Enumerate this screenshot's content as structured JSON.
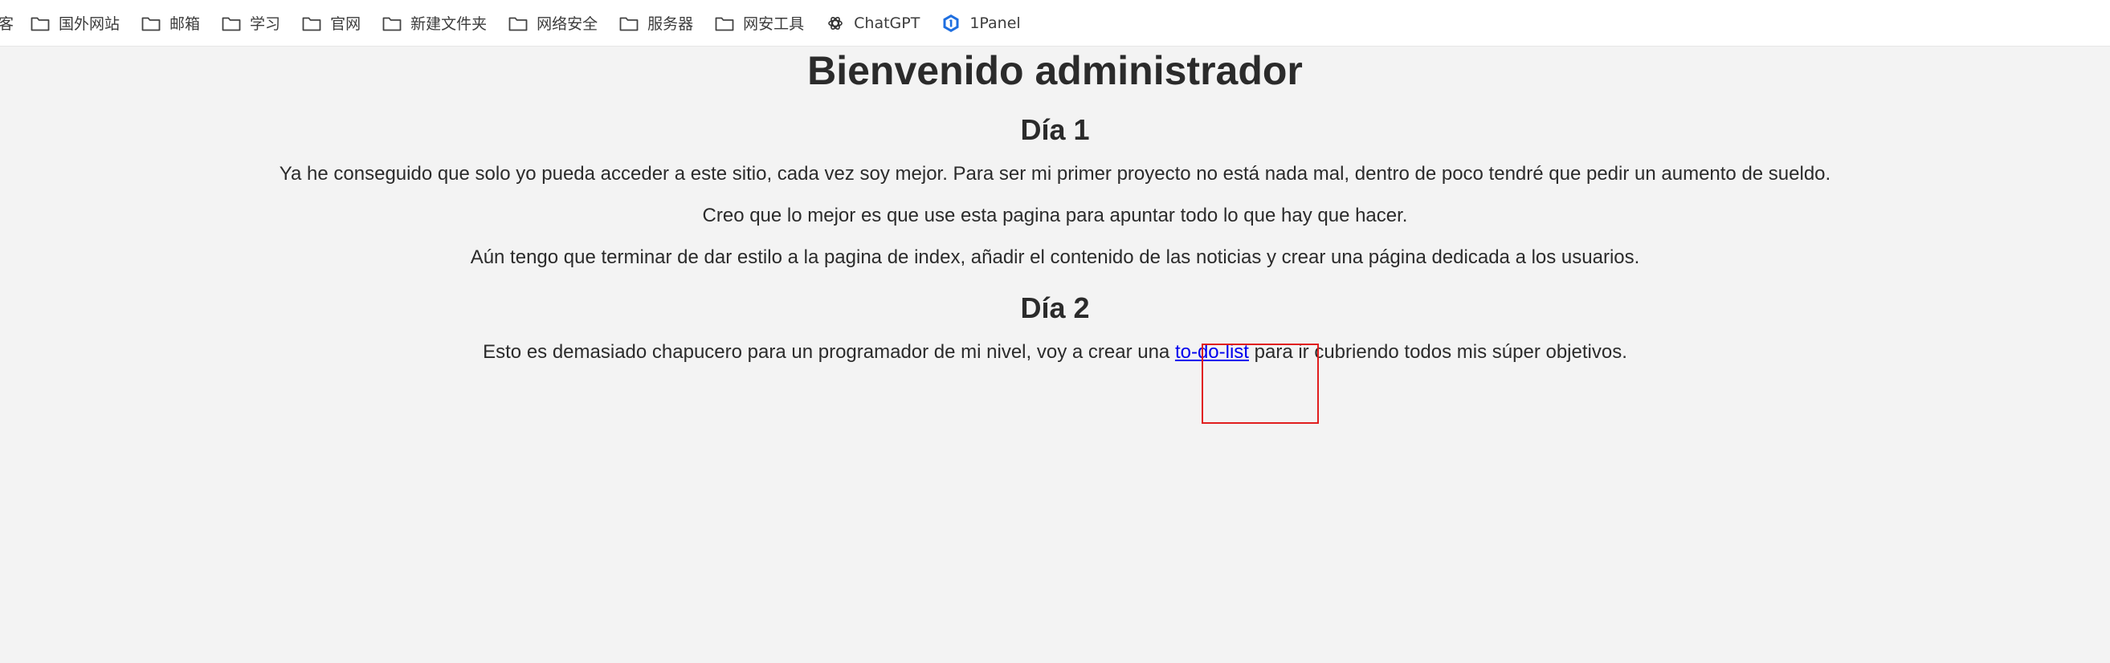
{
  "bookmarks": {
    "partial_label": "客",
    "items": [
      {
        "label": "国外网站",
        "icon": "folder-icon"
      },
      {
        "label": "邮箱",
        "icon": "folder-icon"
      },
      {
        "label": "学习",
        "icon": "folder-icon"
      },
      {
        "label": "官网",
        "icon": "folder-icon"
      },
      {
        "label": "新建文件夹",
        "icon": "folder-icon"
      },
      {
        "label": "网络安全",
        "icon": "folder-icon"
      },
      {
        "label": "服务器",
        "icon": "folder-icon"
      },
      {
        "label": "网安工具",
        "icon": "folder-icon"
      },
      {
        "label": "ChatGPT",
        "icon": "chatgpt-icon"
      },
      {
        "label": "1Panel",
        "icon": "1panel-icon"
      }
    ]
  },
  "page": {
    "title": "Bienvenido administrador",
    "day1": {
      "heading": "Día 1",
      "paragraphs": [
        "Ya he conseguido que solo yo pueda acceder a este sitio, cada vez soy mejor. Para ser mi primer proyecto no está nada mal, dentro de poco tendré que pedir un aumento de sueldo.",
        "Creo que lo mejor es que use esta pagina para apuntar todo lo que hay que hacer.",
        "Aún tengo que terminar de dar estilo a la pagina de index, añadir el contenido de las noticias y crear una página dedicada a los usuarios."
      ]
    },
    "day2": {
      "heading": "Día 2",
      "text_before": "Esto es demasiado chapucero para un programador de mi nivel, voy a crear una ",
      "link_text": "to-do-list",
      "text_after": " para ir cubriendo todos mis súper objetivos."
    }
  },
  "colors": {
    "link": "#0000ee",
    "highlight": "#e01e1e",
    "background": "#f3f3f3"
  }
}
